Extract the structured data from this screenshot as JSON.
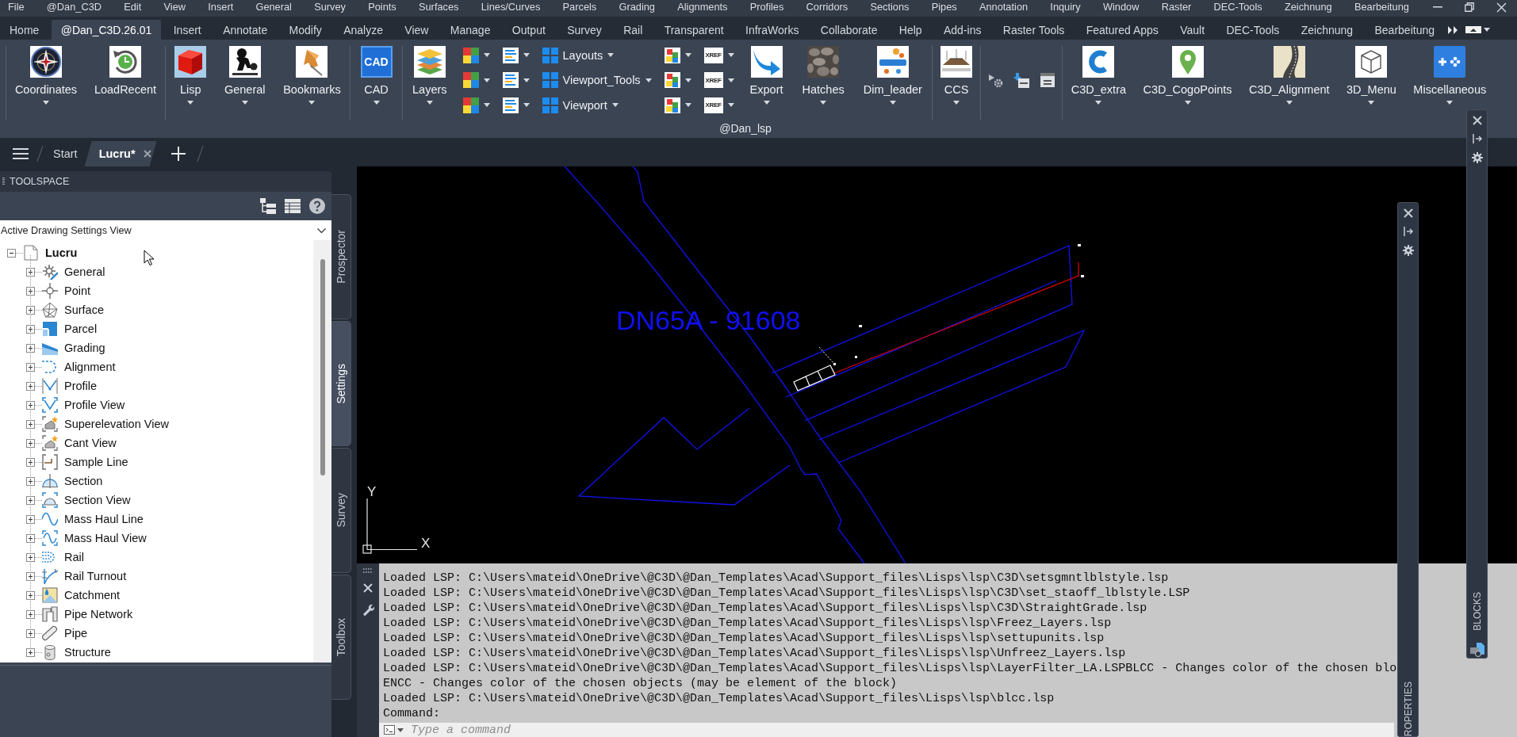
{
  "menu_bar": {
    "items": [
      "File",
      "@Dan_C3D",
      "Edit",
      "View",
      "Insert",
      "General",
      "Survey",
      "Points",
      "Surfaces",
      "Lines/Curves",
      "Parcels",
      "Grading",
      "Alignments",
      "Profiles",
      "Corridors",
      "Sections",
      "Pipes",
      "Annotation",
      "Inquiry",
      "Window",
      "Raster",
      "DEC-Tools",
      "Zeichnung",
      "Bearbeitung"
    ]
  },
  "ribbon": {
    "tabs": [
      {
        "label": "Home",
        "selected": false
      },
      {
        "label": "@Dan_C3D.26.01",
        "selected": true
      },
      {
        "label": "Insert",
        "selected": false
      },
      {
        "label": "Annotate",
        "selected": false
      },
      {
        "label": "Modify",
        "selected": false
      },
      {
        "label": "Analyze",
        "selected": false
      },
      {
        "label": "View",
        "selected": false
      },
      {
        "label": "Manage",
        "selected": false
      },
      {
        "label": "Output",
        "selected": false
      },
      {
        "label": "Survey",
        "selected": false
      },
      {
        "label": "Rail",
        "selected": false
      },
      {
        "label": "Transparent",
        "selected": false
      },
      {
        "label": "InfraWorks",
        "selected": false
      },
      {
        "label": "Collaborate",
        "selected": false
      },
      {
        "label": "Help",
        "selected": false
      },
      {
        "label": "Add-ins",
        "selected": false
      },
      {
        "label": "Raster Tools",
        "selected": false
      },
      {
        "label": "Featured Apps",
        "selected": false
      },
      {
        "label": "Vault",
        "selected": false
      },
      {
        "label": "DEC-Tools",
        "selected": false
      },
      {
        "label": "Zeichnung",
        "selected": false
      },
      {
        "label": "Bearbeitung",
        "selected": false
      }
    ],
    "groups": [
      {
        "items": [
          {
            "kind": "large",
            "label": "Coordinates",
            "dropdown": true
          },
          {
            "kind": "large",
            "label": "LoadRecent",
            "dropdown": false
          }
        ]
      },
      {
        "items": [
          {
            "kind": "large",
            "label": "Lisp",
            "dropdown": true
          },
          {
            "kind": "large",
            "label": "General",
            "dropdown": true
          },
          {
            "kind": "large",
            "label": "Bookmarks",
            "dropdown": true
          }
        ]
      },
      {
        "items": [
          {
            "kind": "large",
            "label": "CAD",
            "icon_text": "CAD",
            "dropdown": true
          }
        ]
      },
      {
        "items": [
          {
            "kind": "large",
            "label": "Layers",
            "dropdown": true
          },
          {
            "kind": "stack",
            "rows": [
              {
                "dropdown": true
              },
              {
                "dropdown": true
              },
              {
                "dropdown": true
              }
            ]
          },
          {
            "kind": "stack",
            "rows": [
              {
                "dropdown": true
              },
              {
                "dropdown": true
              },
              {
                "dropdown": true
              }
            ]
          },
          {
            "kind": "stack",
            "rows": [
              {
                "label": "Layouts",
                "dropdown": true
              },
              {
                "label": "Viewport_Tools",
                "dropdown": true
              },
              {
                "label": "Viewport",
                "dropdown": true
              }
            ]
          },
          {
            "kind": "stack",
            "rows": [
              {
                "dropdown": true
              },
              {
                "dropdown": true
              },
              {
                "dropdown": true
              }
            ]
          },
          {
            "kind": "stack",
            "rows": [
              {
                "icon_text": "XREF",
                "dropdown": true
              },
              {
                "icon_text": "XREF",
                "dropdown": true
              },
              {
                "icon_text": "XREF",
                "dropdown": true
              }
            ]
          },
          {
            "kind": "large",
            "label": "Export",
            "dropdown": true
          },
          {
            "kind": "large",
            "label": "Hatches",
            "dropdown": true
          },
          {
            "kind": "large",
            "label": "Dim_leader",
            "dropdown": true
          }
        ]
      },
      {
        "items": [
          {
            "kind": "large",
            "label": "CCS",
            "dropdown": true
          }
        ]
      },
      {
        "items": [
          {
            "kind": "tools"
          }
        ]
      },
      {
        "items": [
          {
            "kind": "large",
            "label": "C3D_extra",
            "dropdown": true
          },
          {
            "kind": "large",
            "label": "C3D_CogoPoints",
            "dropdown": true
          },
          {
            "kind": "large",
            "label": "C3D_Alignment",
            "dropdown": true
          },
          {
            "kind": "large",
            "label": "3D_Menu",
            "dropdown": true
          },
          {
            "kind": "large",
            "label": "Miscellaneous",
            "dropdown": true
          }
        ]
      }
    ],
    "panel_title": "@Dan_lsp"
  },
  "file_tabs": [
    {
      "label": "Start",
      "selected": false
    },
    {
      "label": "Lucru*",
      "selected": true
    }
  ],
  "toolspace": {
    "title": "TOOLSPACE",
    "view": "Active Drawing Settings View",
    "tree": {
      "label": "Lucru",
      "expanded": true,
      "children": [
        {
          "label": "General",
          "expanded": false
        },
        {
          "label": "Point",
          "expanded": false
        },
        {
          "label": "Surface",
          "expanded": false
        },
        {
          "label": "Parcel",
          "expanded": false
        },
        {
          "label": "Grading",
          "expanded": false
        },
        {
          "label": "Alignment",
          "expanded": false
        },
        {
          "label": "Profile",
          "expanded": false
        },
        {
          "label": "Profile View",
          "expanded": false
        },
        {
          "label": "Superelevation View",
          "expanded": false
        },
        {
          "label": "Cant View",
          "expanded": false
        },
        {
          "label": "Sample Line",
          "expanded": false
        },
        {
          "label": "Section",
          "expanded": false
        },
        {
          "label": "Section View",
          "expanded": false
        },
        {
          "label": "Mass Haul Line",
          "expanded": false
        },
        {
          "label": "Mass Haul View",
          "expanded": false
        },
        {
          "label": "Rail",
          "expanded": false
        },
        {
          "label": "Rail Turnout",
          "expanded": false
        },
        {
          "label": "Catchment",
          "expanded": false
        },
        {
          "label": "Pipe Network",
          "expanded": false
        },
        {
          "label": "Pipe",
          "expanded": false
        },
        {
          "label": "Structure",
          "expanded": false
        }
      ]
    },
    "side_tabs": [
      {
        "label": "Prospector",
        "selected": false
      },
      {
        "label": "Settings",
        "selected": true
      },
      {
        "label": "Survey",
        "selected": false
      },
      {
        "label": "Toolbox",
        "selected": false
      }
    ]
  },
  "drawing": {
    "label": "DN65A - 91608",
    "ucs": {
      "y_label": "Y",
      "x_label": "X"
    }
  },
  "command_line": {
    "history": [
      "Loaded LSP: C:\\Users\\mateid\\OneDrive\\@C3D\\@Dan_Templates\\Acad\\Support_files\\Lisps\\lsp\\C3D\\setsgmntlblstyle.lsp",
      "Loaded LSP: C:\\Users\\mateid\\OneDrive\\@C3D\\@Dan_Templates\\Acad\\Support_files\\Lisps\\lsp\\C3D\\set_staoff_lblstyle.LSP",
      "Loaded LSP: C:\\Users\\mateid\\OneDrive\\@C3D\\@Dan_Templates\\Acad\\Support_files\\Lisps\\lsp\\C3D\\StraightGrade.lsp",
      "Loaded LSP: C:\\Users\\mateid\\OneDrive\\@C3D\\@Dan_Templates\\Acad\\Support_files\\Lisps\\lsp\\Freez_Layers.lsp",
      "Loaded LSP: C:\\Users\\mateid\\OneDrive\\@C3D\\@Dan_Templates\\Acad\\Support_files\\Lisps\\lsp\\settupunits.lsp",
      "Loaded LSP: C:\\Users\\mateid\\OneDrive\\@C3D\\@Dan_Templates\\Acad\\Support_files\\Lisps\\lsp\\Unfreez_Layers.lsp",
      "Loaded LSP: C:\\Users\\mateid\\OneDrive\\@C3D\\@Dan_Templates\\Acad\\Support_files\\Lisps\\lsp\\LayerFilter_LA.LSPBLCC - Changes color of the chosen blo",
      "ENCC - Changes color of the chosen objects (may be element of the block)",
      "Loaded LSP: C:\\Users\\mateid\\OneDrive\\@C3D\\@Dan_Templates\\Acad\\Support_files\\Lisps\\lsp\\blcc.lsp",
      "Command:"
    ],
    "input": {
      "placeholder": "Type a command"
    }
  },
  "palettes": [
    {
      "kind": "properties",
      "label": "ROPERTIES"
    },
    {
      "kind": "blocks",
      "label": "BLOCKS"
    }
  ]
}
